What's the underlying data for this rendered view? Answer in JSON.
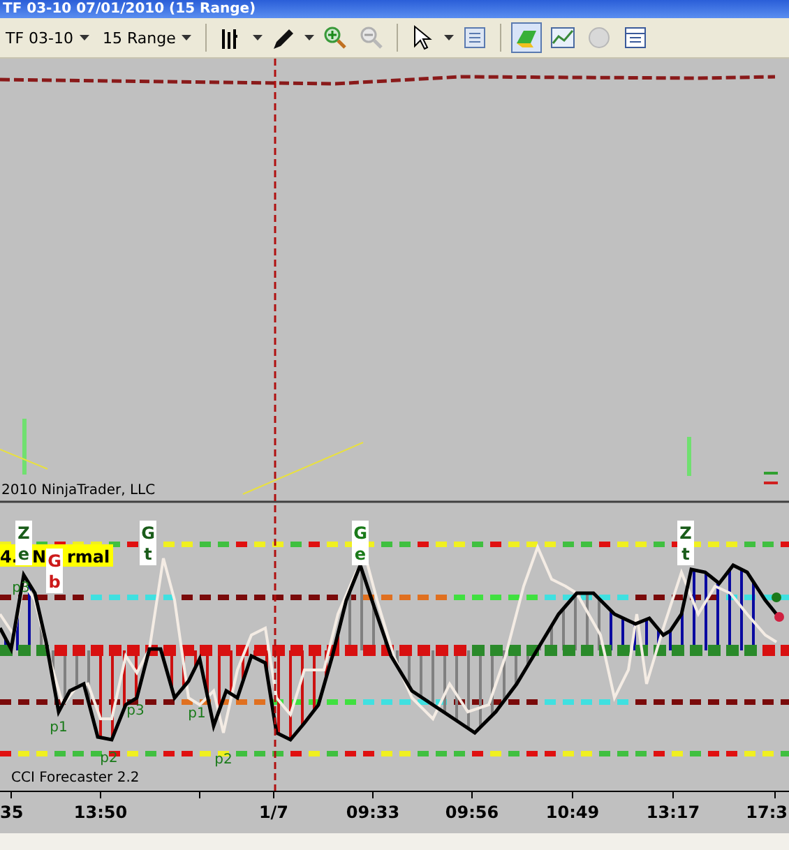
{
  "window": {
    "title": "TF 03-10  07/01/2010 (15 Range)"
  },
  "toolbar": {
    "instrument": "TF 03-10",
    "interval": "15 Range",
    "tools": [
      {
        "kind": "bars",
        "selected": false
      },
      {
        "kind": "pencil",
        "selected": false
      },
      {
        "kind": "zoom-in",
        "selected": false
      },
      {
        "kind": "zoom-out",
        "selected": false
      },
      {
        "kind": "pointer",
        "selected": false
      },
      {
        "kind": "properties",
        "selected": false
      },
      {
        "kind": "chart-trader",
        "selected": true
      },
      {
        "kind": "indicators",
        "selected": false
      },
      {
        "kind": "strategy",
        "selected": false
      },
      {
        "kind": "data-box",
        "selected": false
      }
    ]
  },
  "price_panel": {
    "copyright": "2010 NinjaTrader, LLC"
  },
  "cci_panel": {
    "title": "CCI Forecaster 2.2",
    "status_box": {
      "parts": [
        "4.",
        "N",
        "rmal"
      ]
    },
    "markers": [
      {
        "top": "Z",
        "bottom": "e",
        "color": "#1a5c1a"
      },
      {
        "top": "G",
        "bottom": "b",
        "color": "#cc1a1a"
      },
      {
        "top": "G",
        "bottom": "t",
        "color": "#1a5c1a"
      },
      {
        "top": "G",
        "bottom": "e",
        "color": "#1a7a1a"
      },
      {
        "top": "Z",
        "bottom": "t",
        "color": "#1a5c1a"
      }
    ],
    "pivots": [
      "p3",
      "p1",
      "p2",
      "p3",
      "p1",
      "p2"
    ]
  },
  "x_axis": {
    "labels": [
      "35",
      "13:50",
      "1/7",
      "09:33",
      "09:56",
      "10:49",
      "13:17",
      "17:3"
    ]
  }
}
